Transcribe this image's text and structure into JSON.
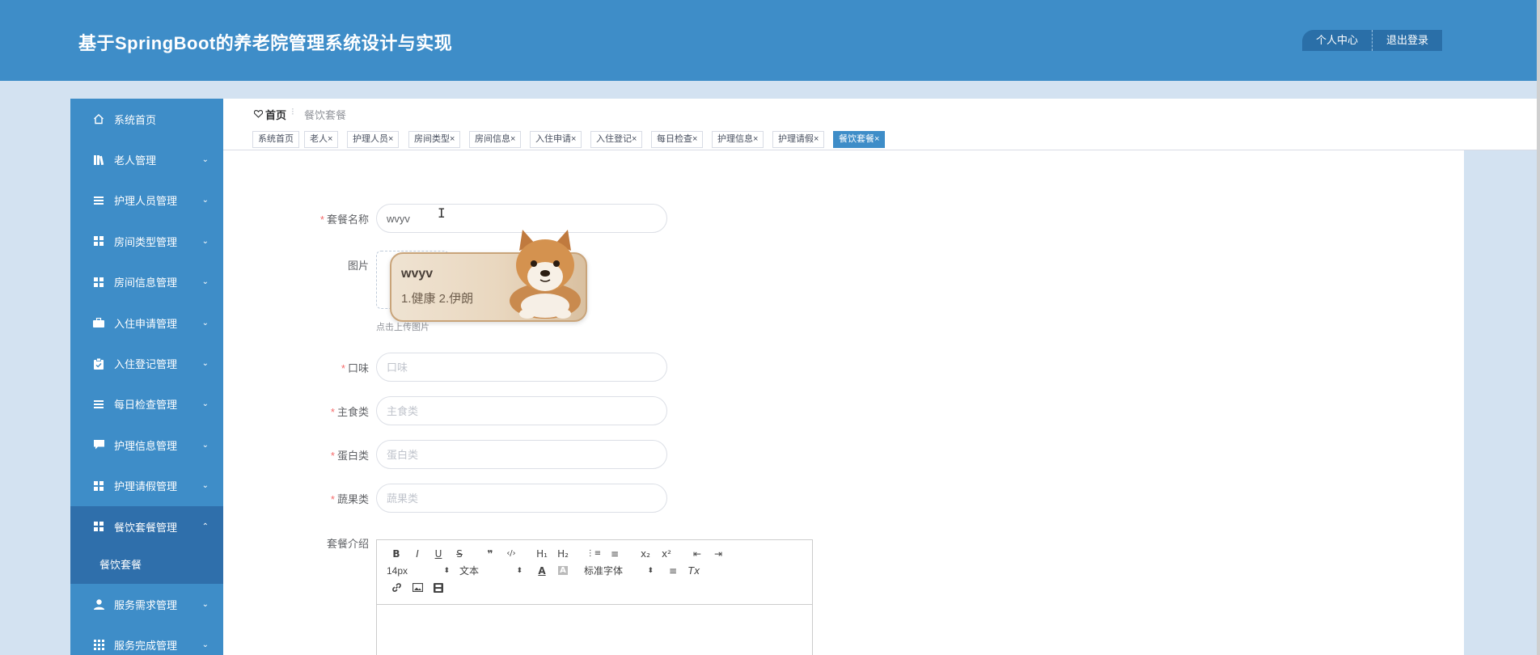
{
  "header": {
    "title": "基于SpringBoot的养老院管理系统设计与实现",
    "personal_center": "个人中心",
    "logout": "退出登录"
  },
  "sidebar": {
    "items": [
      {
        "label": "系统首页",
        "icon": "home-icon"
      },
      {
        "label": "老人管理",
        "icon": "book-icon",
        "arrow": "⌄"
      },
      {
        "label": "护理人员管理",
        "icon": "list-icon",
        "arrow": "⌄"
      },
      {
        "label": "房间类型管理",
        "icon": "grid-icon",
        "arrow": "⌄"
      },
      {
        "label": "房间信息管理",
        "icon": "grid-icon",
        "arrow": "⌄"
      },
      {
        "label": "入住申请管理",
        "icon": "briefcase-icon",
        "arrow": "⌄"
      },
      {
        "label": "入住登记管理",
        "icon": "clipboard-icon",
        "arrow": "⌄"
      },
      {
        "label": "每日检查管理",
        "icon": "list-icon",
        "arrow": "⌄"
      },
      {
        "label": "护理信息管理",
        "icon": "comment-icon",
        "arrow": "⌄"
      },
      {
        "label": "护理请假管理",
        "icon": "grid-icon",
        "arrow": "⌄"
      },
      {
        "label": "餐饮套餐管理",
        "icon": "grid-icon",
        "arrow": "⌃"
      },
      {
        "label": "服务需求管理",
        "icon": "user-icon",
        "arrow": "⌄"
      },
      {
        "label": "服务完成管理",
        "icon": "grid-icon",
        "arrow": "⌄"
      }
    ],
    "submenu_label": "餐饮套餐"
  },
  "breadcrumb": {
    "home": "首页",
    "separator": "⁝",
    "current": "餐饮套餐"
  },
  "tags": [
    "系统首页",
    "老人×",
    "护理人员×",
    "房间类型×",
    "房间信息×",
    "入住申请×",
    "入住登记×",
    "每日检查×",
    "护理信息×",
    "护理请假×",
    "餐饮套餐×"
  ],
  "form": {
    "name_label": "套餐名称",
    "name_value": "wvyv",
    "image_label": "图片",
    "upload_tip": "点击上传图片",
    "taste_label": "口味",
    "taste_placeholder": "口味",
    "staple_label": "主食类",
    "staple_placeholder": "主食类",
    "protein_label": "蛋白类",
    "protein_placeholder": "蛋白类",
    "veg_label": "蔬果类",
    "veg_placeholder": "蔬果类",
    "intro_label": "套餐介绍",
    "required_mark": "*"
  },
  "ime": {
    "composition": "wvyv",
    "candidates": "1.健康  2.伊朗"
  },
  "editor": {
    "row1": [
      "B",
      "I",
      "U",
      "S",
      "❞",
      "‹/›",
      "H₁",
      "H₂",
      "⋮≡",
      "≡",
      "x₂",
      "x²",
      "⇤",
      "⇥"
    ],
    "font_size": "14px",
    "block_type": "文本",
    "font_family": "标准字体",
    "select_arrow": "⬍",
    "color_btn": "A",
    "bg_btn": "A",
    "align_btn": "≡",
    "clear_btn": "Tx",
    "row3": [
      "🔗",
      "▣",
      "▦"
    ]
  },
  "colors": {
    "brand": "#3e8dc8",
    "sidebar_active": "#2f6fab",
    "page_bg": "#d3e2f1",
    "required": "#f56c6c"
  }
}
